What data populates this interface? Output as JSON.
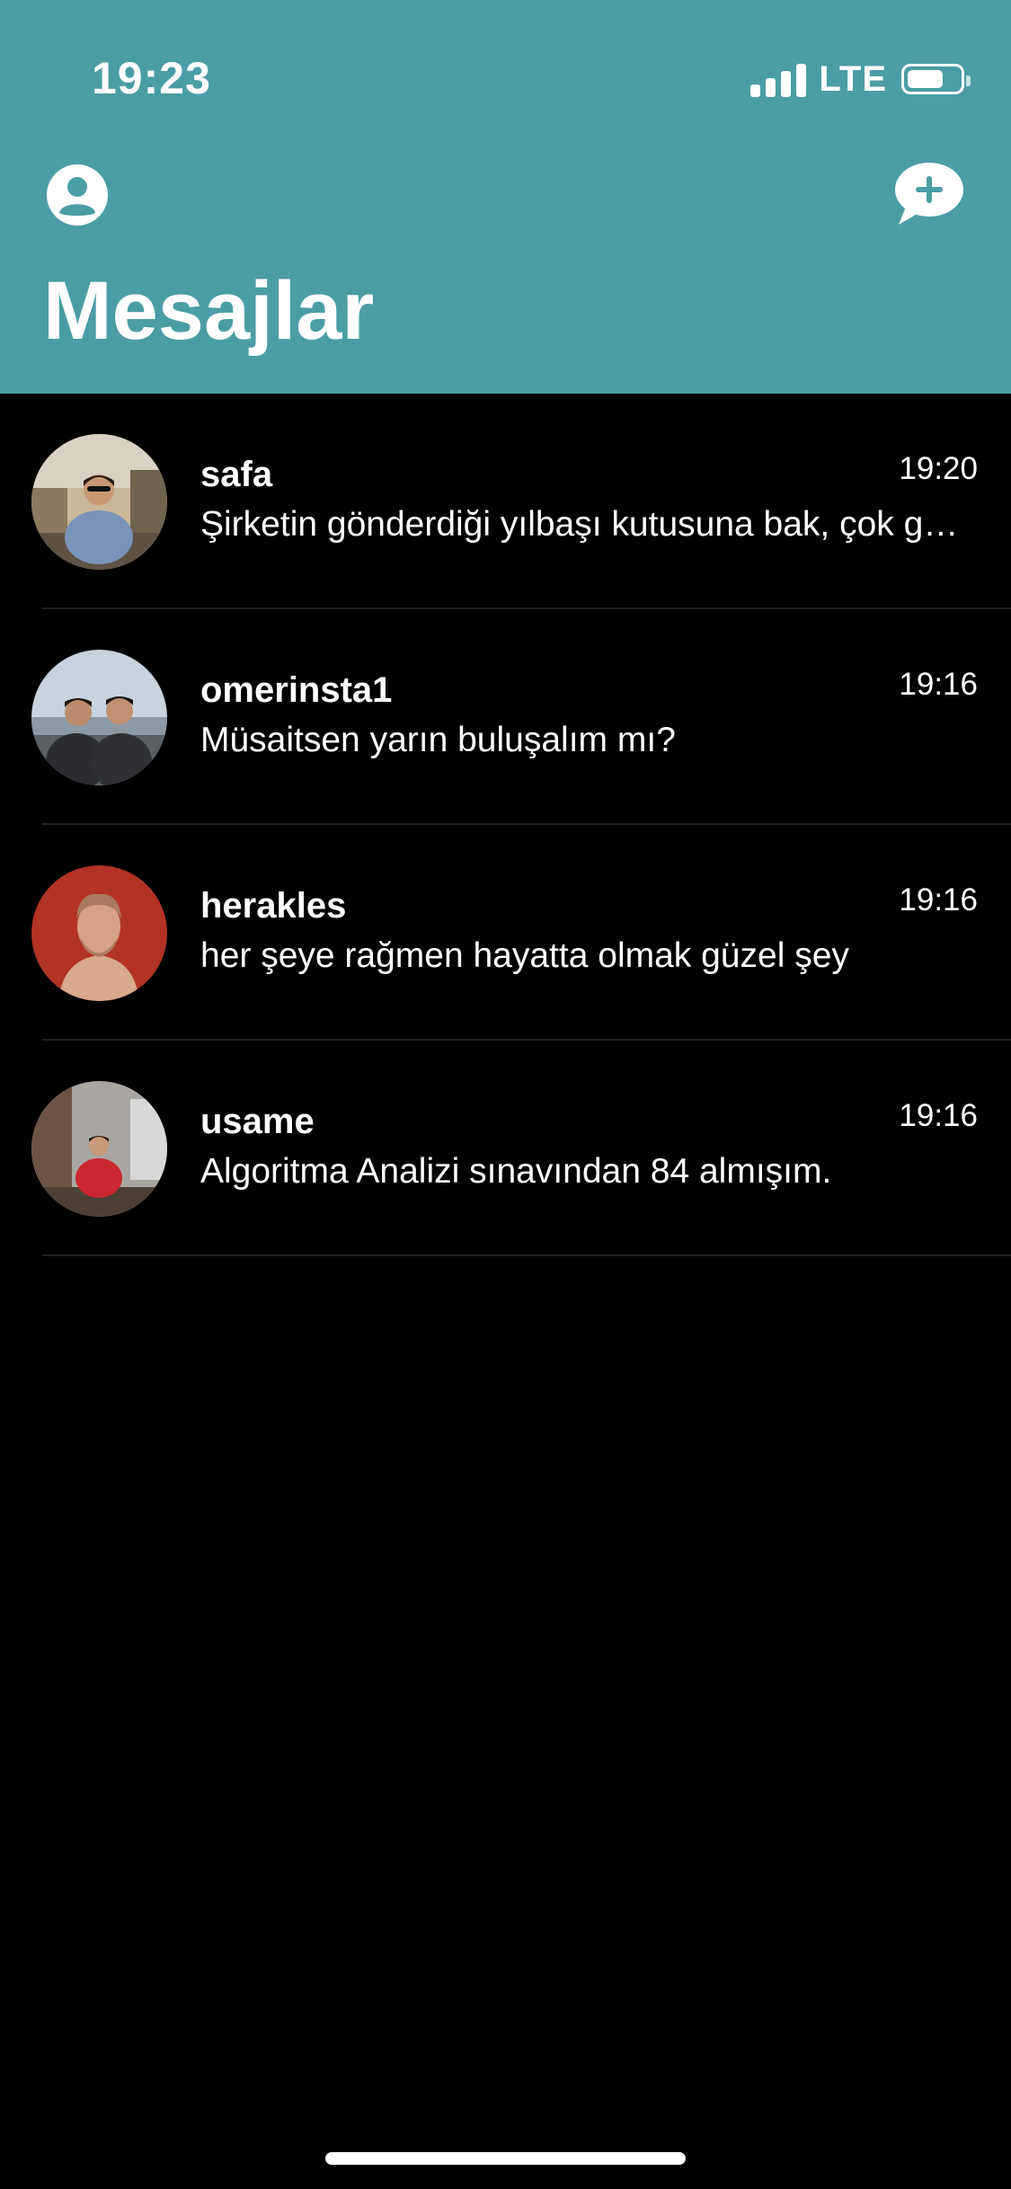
{
  "status_bar": {
    "time": "19:23",
    "network": "LTE",
    "icons": [
      "signal-icon",
      "battery-icon"
    ]
  },
  "header": {
    "title": "Mesajlar",
    "bg_color": "#4b9da5",
    "left_icon": "profile-icon",
    "right_icon": "new-message-icon"
  },
  "conversations": [
    {
      "name": "safa",
      "time": "19:20",
      "message": "Şirketin gönderdiği yılbaşı kutusuna bak, çok güzel"
    },
    {
      "name": "omerinsta1",
      "time": "19:16",
      "message": "Müsaitsen yarın buluşalım mı?"
    },
    {
      "name": "herakles",
      "time": "19:16",
      "message": "her şeye rağmen hayatta olmak güzel şey"
    },
    {
      "name": "usame",
      "time": "19:16",
      "message": "Algoritma Analizi sınavından 84 almışım."
    }
  ]
}
